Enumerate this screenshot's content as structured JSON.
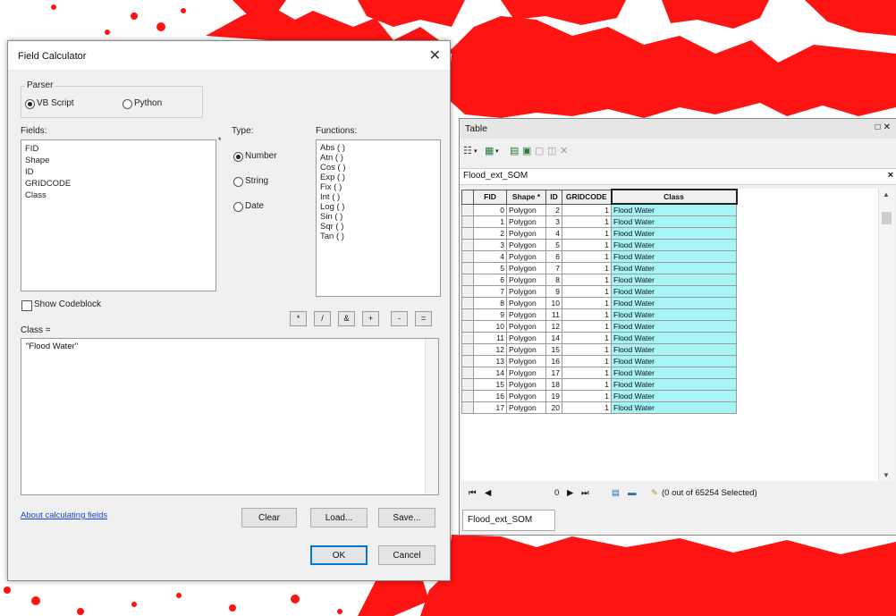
{
  "colors": {
    "flood": "#ff1414",
    "selected_cells": "#a6f4f6",
    "link": "#1a3fd6"
  },
  "field_calculator": {
    "title": "Field Calculator",
    "parser_label": "Parser",
    "parser_options": [
      "VB Script",
      "Python"
    ],
    "parser_selected": "VB Script",
    "fields_label": "Fields:",
    "fields": [
      "FID",
      "Shape",
      "ID",
      "GRIDCODE",
      "Class"
    ],
    "type_label": "Type:",
    "types": [
      "Number",
      "String",
      "Date"
    ],
    "type_selected": "Number",
    "functions_label": "Functions:",
    "functions": [
      "Abs ( )",
      "Atn ( )",
      "Cos ( )",
      "Exp ( )",
      "Fix ( )",
      "Int ( )",
      "Log ( )",
      "Sin ( )",
      "Sqr ( )",
      "Tan ( )"
    ],
    "show_codeblock_label": "Show Codeblock",
    "operators": [
      "*",
      "/",
      "&",
      "+",
      "-",
      "="
    ],
    "expression_label": "Class =",
    "expression": "\"Flood Water\"",
    "about_link": "About calculating fields",
    "clear_label": "Clear",
    "load_label": "Load...",
    "save_label": "Save...",
    "ok_label": "OK",
    "cancel_label": "Cancel"
  },
  "table_window": {
    "title": "Table",
    "layer_tab": "Flood_ext_SOM",
    "columns": [
      "FID",
      "Shape *",
      "ID",
      "GRIDCODE",
      "Class"
    ],
    "rows": [
      [
        "0",
        "Polygon",
        "2",
        "1",
        "Flood Water"
      ],
      [
        "1",
        "Polygon",
        "3",
        "1",
        "Flood Water"
      ],
      [
        "2",
        "Polygon",
        "4",
        "1",
        "Flood Water"
      ],
      [
        "3",
        "Polygon",
        "5",
        "1",
        "Flood Water"
      ],
      [
        "4",
        "Polygon",
        "6",
        "1",
        "Flood Water"
      ],
      [
        "5",
        "Polygon",
        "7",
        "1",
        "Flood Water"
      ],
      [
        "6",
        "Polygon",
        "8",
        "1",
        "Flood Water"
      ],
      [
        "7",
        "Polygon",
        "9",
        "1",
        "Flood Water"
      ],
      [
        "8",
        "Polygon",
        "10",
        "1",
        "Flood Water"
      ],
      [
        "9",
        "Polygon",
        "11",
        "1",
        "Flood Water"
      ],
      [
        "10",
        "Polygon",
        "12",
        "1",
        "Flood Water"
      ],
      [
        "11",
        "Polygon",
        "14",
        "1",
        "Flood Water"
      ],
      [
        "12",
        "Polygon",
        "15",
        "1",
        "Flood Water"
      ],
      [
        "13",
        "Polygon",
        "16",
        "1",
        "Flood Water"
      ],
      [
        "14",
        "Polygon",
        "17",
        "1",
        "Flood Water"
      ],
      [
        "15",
        "Polygon",
        "18",
        "1",
        "Flood Water"
      ],
      [
        "16",
        "Polygon",
        "19",
        "1",
        "Flood Water"
      ],
      [
        "17",
        "Polygon",
        "20",
        "1",
        "Flood Water"
      ]
    ],
    "record_position": "0",
    "selection_status": "(0 out of 65254 Selected)",
    "bottom_tab": "Flood_ext_SOM"
  }
}
